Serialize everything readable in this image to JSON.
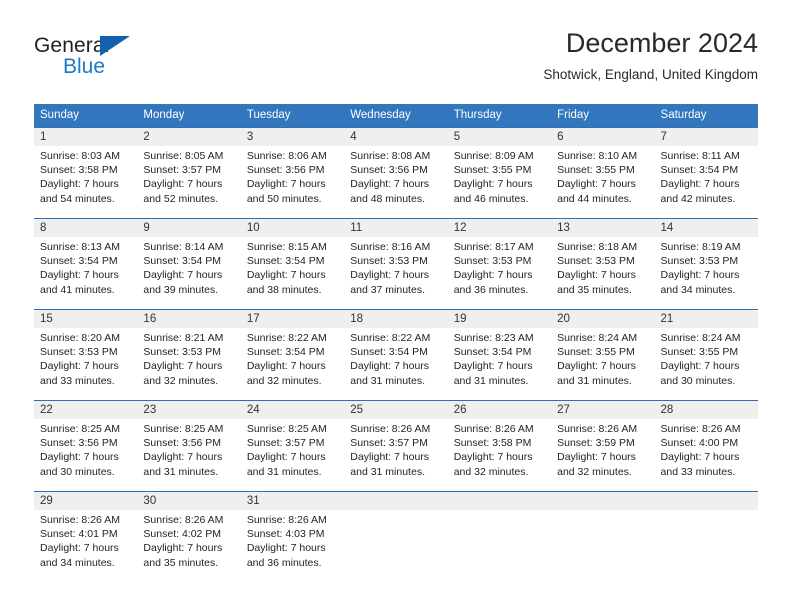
{
  "logo": {
    "word_one": "General",
    "word_two": "Blue",
    "triangle_icon": "blue-triangle-icon",
    "accent_color": "#1263ab",
    "blue_text_color": "#1d78c8"
  },
  "header": {
    "title": "December 2024",
    "location": "Shotwick, England, United Kingdom"
  },
  "calendar": {
    "header_bg": "#3277bd",
    "header_text_color": "#ffffff",
    "daynum_bg": "#efefef",
    "weekdays": [
      "Sunday",
      "Monday",
      "Tuesday",
      "Wednesday",
      "Thursday",
      "Friday",
      "Saturday"
    ],
    "weeks": [
      [
        {
          "day": "1",
          "sunrise": "Sunrise: 8:03 AM",
          "sunset": "Sunset: 3:58 PM",
          "daylight_line1": "Daylight: 7 hours",
          "daylight_line2": "and 54 minutes."
        },
        {
          "day": "2",
          "sunrise": "Sunrise: 8:05 AM",
          "sunset": "Sunset: 3:57 PM",
          "daylight_line1": "Daylight: 7 hours",
          "daylight_line2": "and 52 minutes."
        },
        {
          "day": "3",
          "sunrise": "Sunrise: 8:06 AM",
          "sunset": "Sunset: 3:56 PM",
          "daylight_line1": "Daylight: 7 hours",
          "daylight_line2": "and 50 minutes."
        },
        {
          "day": "4",
          "sunrise": "Sunrise: 8:08 AM",
          "sunset": "Sunset: 3:56 PM",
          "daylight_line1": "Daylight: 7 hours",
          "daylight_line2": "and 48 minutes."
        },
        {
          "day": "5",
          "sunrise": "Sunrise: 8:09 AM",
          "sunset": "Sunset: 3:55 PM",
          "daylight_line1": "Daylight: 7 hours",
          "daylight_line2": "and 46 minutes."
        },
        {
          "day": "6",
          "sunrise": "Sunrise: 8:10 AM",
          "sunset": "Sunset: 3:55 PM",
          "daylight_line1": "Daylight: 7 hours",
          "daylight_line2": "and 44 minutes."
        },
        {
          "day": "7",
          "sunrise": "Sunrise: 8:11 AM",
          "sunset": "Sunset: 3:54 PM",
          "daylight_line1": "Daylight: 7 hours",
          "daylight_line2": "and 42 minutes."
        }
      ],
      [
        {
          "day": "8",
          "sunrise": "Sunrise: 8:13 AM",
          "sunset": "Sunset: 3:54 PM",
          "daylight_line1": "Daylight: 7 hours",
          "daylight_line2": "and 41 minutes."
        },
        {
          "day": "9",
          "sunrise": "Sunrise: 8:14 AM",
          "sunset": "Sunset: 3:54 PM",
          "daylight_line1": "Daylight: 7 hours",
          "daylight_line2": "and 39 minutes."
        },
        {
          "day": "10",
          "sunrise": "Sunrise: 8:15 AM",
          "sunset": "Sunset: 3:54 PM",
          "daylight_line1": "Daylight: 7 hours",
          "daylight_line2": "and 38 minutes."
        },
        {
          "day": "11",
          "sunrise": "Sunrise: 8:16 AM",
          "sunset": "Sunset: 3:53 PM",
          "daylight_line1": "Daylight: 7 hours",
          "daylight_line2": "and 37 minutes."
        },
        {
          "day": "12",
          "sunrise": "Sunrise: 8:17 AM",
          "sunset": "Sunset: 3:53 PM",
          "daylight_line1": "Daylight: 7 hours",
          "daylight_line2": "and 36 minutes."
        },
        {
          "day": "13",
          "sunrise": "Sunrise: 8:18 AM",
          "sunset": "Sunset: 3:53 PM",
          "daylight_line1": "Daylight: 7 hours",
          "daylight_line2": "and 35 minutes."
        },
        {
          "day": "14",
          "sunrise": "Sunrise: 8:19 AM",
          "sunset": "Sunset: 3:53 PM",
          "daylight_line1": "Daylight: 7 hours",
          "daylight_line2": "and 34 minutes."
        }
      ],
      [
        {
          "day": "15",
          "sunrise": "Sunrise: 8:20 AM",
          "sunset": "Sunset: 3:53 PM",
          "daylight_line1": "Daylight: 7 hours",
          "daylight_line2": "and 33 minutes."
        },
        {
          "day": "16",
          "sunrise": "Sunrise: 8:21 AM",
          "sunset": "Sunset: 3:53 PM",
          "daylight_line1": "Daylight: 7 hours",
          "daylight_line2": "and 32 minutes."
        },
        {
          "day": "17",
          "sunrise": "Sunrise: 8:22 AM",
          "sunset": "Sunset: 3:54 PM",
          "daylight_line1": "Daylight: 7 hours",
          "daylight_line2": "and 32 minutes."
        },
        {
          "day": "18",
          "sunrise": "Sunrise: 8:22 AM",
          "sunset": "Sunset: 3:54 PM",
          "daylight_line1": "Daylight: 7 hours",
          "daylight_line2": "and 31 minutes."
        },
        {
          "day": "19",
          "sunrise": "Sunrise: 8:23 AM",
          "sunset": "Sunset: 3:54 PM",
          "daylight_line1": "Daylight: 7 hours",
          "daylight_line2": "and 31 minutes."
        },
        {
          "day": "20",
          "sunrise": "Sunrise: 8:24 AM",
          "sunset": "Sunset: 3:55 PM",
          "daylight_line1": "Daylight: 7 hours",
          "daylight_line2": "and 31 minutes."
        },
        {
          "day": "21",
          "sunrise": "Sunrise: 8:24 AM",
          "sunset": "Sunset: 3:55 PM",
          "daylight_line1": "Daylight: 7 hours",
          "daylight_line2": "and 30 minutes."
        }
      ],
      [
        {
          "day": "22",
          "sunrise": "Sunrise: 8:25 AM",
          "sunset": "Sunset: 3:56 PM",
          "daylight_line1": "Daylight: 7 hours",
          "daylight_line2": "and 30 minutes."
        },
        {
          "day": "23",
          "sunrise": "Sunrise: 8:25 AM",
          "sunset": "Sunset: 3:56 PM",
          "daylight_line1": "Daylight: 7 hours",
          "daylight_line2": "and 31 minutes."
        },
        {
          "day": "24",
          "sunrise": "Sunrise: 8:25 AM",
          "sunset": "Sunset: 3:57 PM",
          "daylight_line1": "Daylight: 7 hours",
          "daylight_line2": "and 31 minutes."
        },
        {
          "day": "25",
          "sunrise": "Sunrise: 8:26 AM",
          "sunset": "Sunset: 3:57 PM",
          "daylight_line1": "Daylight: 7 hours",
          "daylight_line2": "and 31 minutes."
        },
        {
          "day": "26",
          "sunrise": "Sunrise: 8:26 AM",
          "sunset": "Sunset: 3:58 PM",
          "daylight_line1": "Daylight: 7 hours",
          "daylight_line2": "and 32 minutes."
        },
        {
          "day": "27",
          "sunrise": "Sunrise: 8:26 AM",
          "sunset": "Sunset: 3:59 PM",
          "daylight_line1": "Daylight: 7 hours",
          "daylight_line2": "and 32 minutes."
        },
        {
          "day": "28",
          "sunrise": "Sunrise: 8:26 AM",
          "sunset": "Sunset: 4:00 PM",
          "daylight_line1": "Daylight: 7 hours",
          "daylight_line2": "and 33 minutes."
        }
      ],
      [
        {
          "day": "29",
          "sunrise": "Sunrise: 8:26 AM",
          "sunset": "Sunset: 4:01 PM",
          "daylight_line1": "Daylight: 7 hours",
          "daylight_line2": "and 34 minutes."
        },
        {
          "day": "30",
          "sunrise": "Sunrise: 8:26 AM",
          "sunset": "Sunset: 4:02 PM",
          "daylight_line1": "Daylight: 7 hours",
          "daylight_line2": "and 35 minutes."
        },
        {
          "day": "31",
          "sunrise": "Sunrise: 8:26 AM",
          "sunset": "Sunset: 4:03 PM",
          "daylight_line1": "Daylight: 7 hours",
          "daylight_line2": "and 36 minutes."
        },
        {
          "day": "",
          "sunrise": "",
          "sunset": "",
          "daylight_line1": "",
          "daylight_line2": ""
        },
        {
          "day": "",
          "sunrise": "",
          "sunset": "",
          "daylight_line1": "",
          "daylight_line2": ""
        },
        {
          "day": "",
          "sunrise": "",
          "sunset": "",
          "daylight_line1": "",
          "daylight_line2": ""
        },
        {
          "day": "",
          "sunrise": "",
          "sunset": "",
          "daylight_line1": "",
          "daylight_line2": ""
        }
      ]
    ]
  }
}
